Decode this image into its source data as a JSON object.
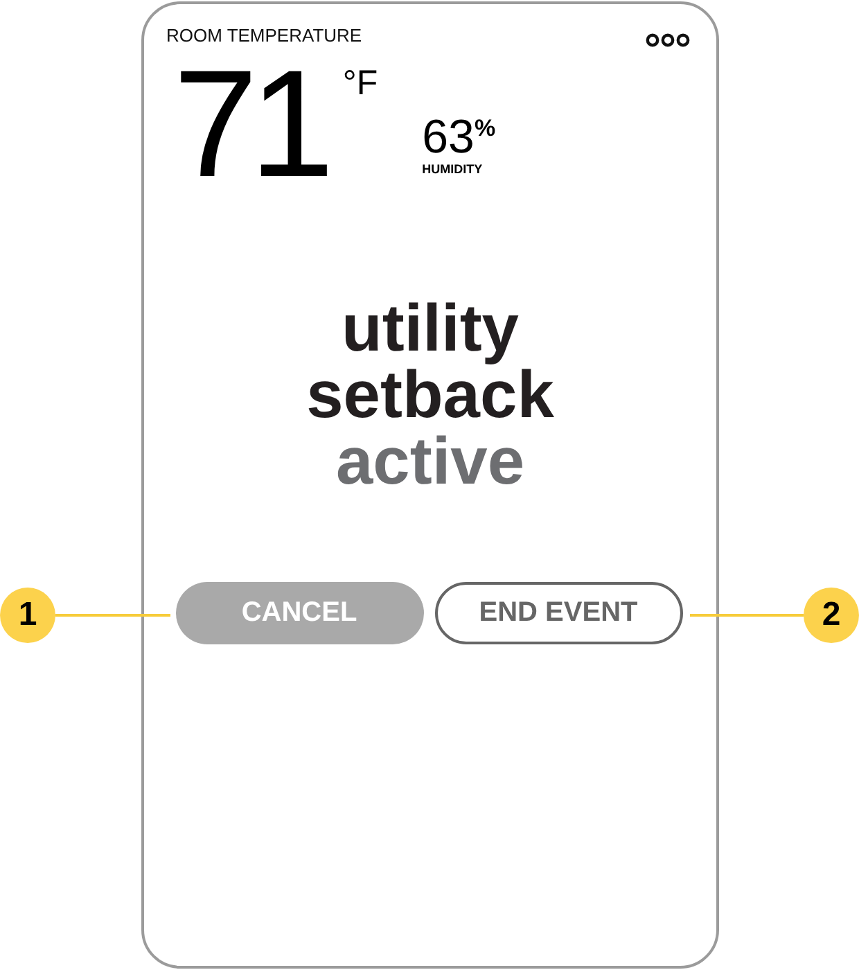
{
  "device": {
    "header_label": "ROOM TEMPERATURE",
    "temperature": {
      "value": "71",
      "unit": "°F"
    },
    "humidity": {
      "value": "63",
      "unit": "%",
      "label": "HUMIDITY"
    },
    "status_message": [
      {
        "text": "utility",
        "kind": "primary"
      },
      {
        "text": "setback",
        "kind": "primary"
      },
      {
        "text": "active",
        "kind": "secondary"
      }
    ],
    "buttons": [
      {
        "label": "CANCEL",
        "kind": "filled"
      },
      {
        "label": "END EVENT",
        "kind": "outlined"
      }
    ]
  },
  "callouts": [
    {
      "number": "1",
      "kind": "left"
    },
    {
      "number": "2",
      "kind": "right"
    }
  ]
}
